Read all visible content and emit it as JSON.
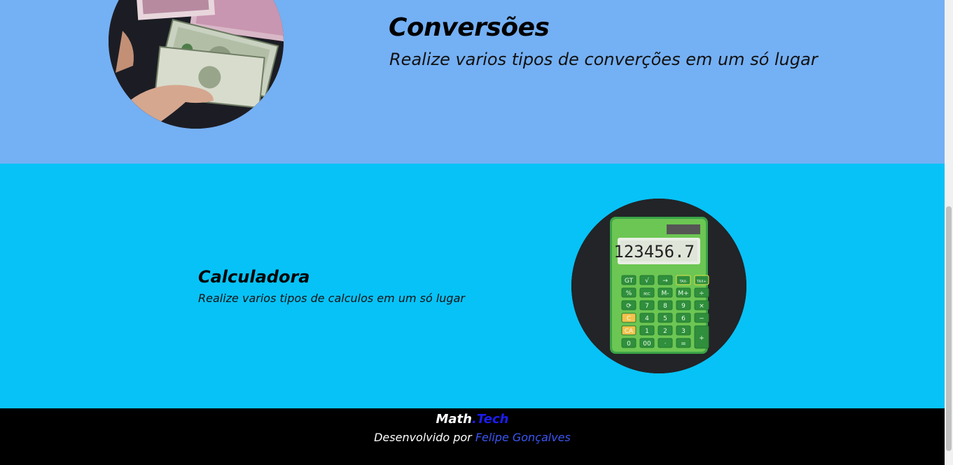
{
  "conversions": {
    "title": "Conversões",
    "subtitle": "Realize varios tipos de converções em um só lugar",
    "image_label": "money-image"
  },
  "calculator": {
    "title": "Calculadora",
    "subtitle": "Realize varios tipos de calculos em um só lugar",
    "display": "123456.7",
    "keys": [
      [
        "GT",
        "√",
        "→",
        "TAX-",
        "TAX+"
      ],
      [
        "%",
        "M/C",
        "M-",
        "M+",
        "÷"
      ],
      [
        "⟳",
        "7",
        "8",
        "9",
        "×"
      ],
      [
        "C",
        "4",
        "5",
        "6",
        "−"
      ],
      [
        "CA",
        "1",
        "2",
        "3",
        "+"
      ],
      [
        "0",
        "00",
        "·",
        "="
      ]
    ]
  },
  "footer": {
    "brand_part1": "Math",
    "brand_part2": ".Tech",
    "dev_prefix": "Desenvolvido por",
    "dev_name": "Felipe Gonçalves"
  },
  "colors": {
    "top_bg": "#74b0f4",
    "mid_bg": "#07c2f7",
    "footer_bg": "#000000",
    "brand_accent": "#1c1cf2",
    "link": "#3b56f5"
  }
}
